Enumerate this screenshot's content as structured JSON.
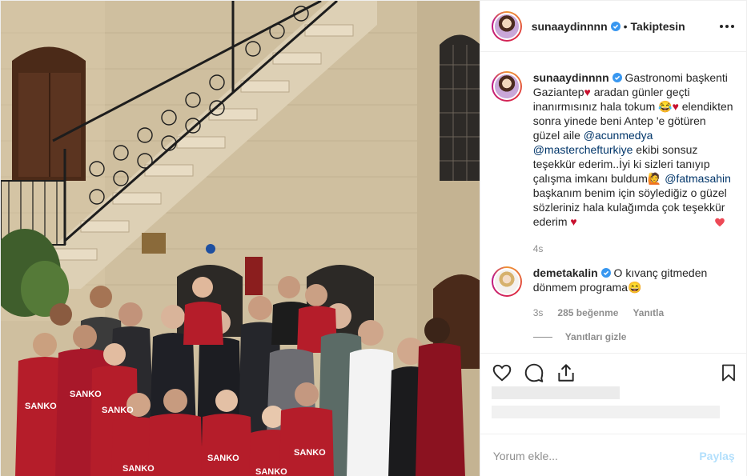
{
  "post": {
    "author": {
      "username": "sunaaydinnnn",
      "verified": true,
      "follow_state": "Takiptesin",
      "separator": "•"
    },
    "photo": {
      "jersey_text": "SANKO"
    },
    "caption": {
      "username": "sunaaydinnnn",
      "parts": {
        "p1": "Gastronomi başkenti Gaziantep",
        "p2": " aradan günler geçti inanırmısınız hala tokum ",
        "p3": " elendikten sonra yinede beni Antep 'e götüren güzel aile ",
        "mention1": "@acunmedya",
        "mention2": "@masterchefturkiye",
        "p4": " ekibi sonsuz teşekkür ederim..İyi ki sizleri tanıyıp çalışma imkanı buldum",
        "mention3": "@fatmasahin",
        "p5": " başkanım benim için söylediğiz o güzel sözleriniz hala kulağımda çok teşekkür ederim "
      },
      "emojis": {
        "heart": "♥",
        "grin": "😂",
        "woman": "🙋"
      },
      "time": "4s"
    },
    "comment": {
      "username": "demetakalin",
      "verified": true,
      "text": "O kıvanç gitmeden dönmem programa",
      "emoji": "😄",
      "time": "3s",
      "likes": "285 beğenme",
      "reply": "Yanıtla",
      "hide_replies": "Yanıtları gizle",
      "liked": true,
      "like_color": "#ed4956"
    },
    "add_comment": {
      "placeholder": "Yorum ekle...",
      "submit": "Paylaş"
    }
  },
  "icons": {
    "more": "more-options-icon",
    "like": "heart-icon",
    "comment": "comment-icon",
    "share": "share-icon",
    "save": "bookmark-icon",
    "verified": "verified-badge-icon"
  },
  "colors": {
    "text": "#262626",
    "secondary": "#8e8e8e",
    "mention": "#003569",
    "verified": "#3897f0",
    "submit_disabled": "#b2dffc",
    "jersey_red": "#c8102e"
  }
}
